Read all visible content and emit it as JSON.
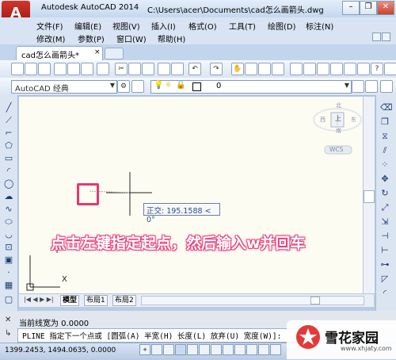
{
  "window": {
    "app_name": "Autodesk AutoCAD 2014",
    "file_path": "C:\\Users\\acer\\Documents\\cad怎么画箭头.dwg",
    "minimize": "–",
    "maximize": "❐",
    "close": "✕"
  },
  "app_button": {
    "letter": "A",
    "arrow": "▼"
  },
  "menu": {
    "row1": [
      "文件(F)",
      "编辑(E)",
      "视图(V)",
      "插入(I)",
      "格式(O)",
      "工具(T)",
      "绘图(D)",
      "标注(N)"
    ],
    "row2": [
      "修改(M)",
      "参数(P)",
      "窗口(W)",
      "帮助(H)"
    ]
  },
  "file_tab": {
    "label": "cad怎么画箭头*",
    "close": "×"
  },
  "toolbar": {
    "workspace": "AutoCAD 经典",
    "layer_value": "0"
  },
  "viewcube": {
    "top_label": "上",
    "north": "北",
    "south": "南",
    "west": "西",
    "east": "东",
    "wcs": "WCS"
  },
  "canvas": {
    "tooltip": "正交: 195.1588 < 0°",
    "annotation": "点击左键指定起点，然后输入w并回车",
    "ucs_x": "X",
    "ucs_y": "Y"
  },
  "layout_tabs": [
    "模型",
    "布局1",
    "布局2"
  ],
  "command": {
    "history": "当前线宽为 0.0000",
    "prompt": "PLINE 指定下一个点或 [圆弧(A) 半宽(H) 长度(L) 放弃(U) 宽度(W)]:",
    "close_icon": "✕"
  },
  "status": {
    "coordinates": "1399.2453, 1494.0635, 0.0000"
  },
  "watermark": {
    "name": "雪花家园",
    "url": "www.xhjaty.com"
  },
  "colors": {
    "annotation": "#e8407a",
    "pickbox": "#e83772",
    "canvas": "#fdfcf2"
  }
}
